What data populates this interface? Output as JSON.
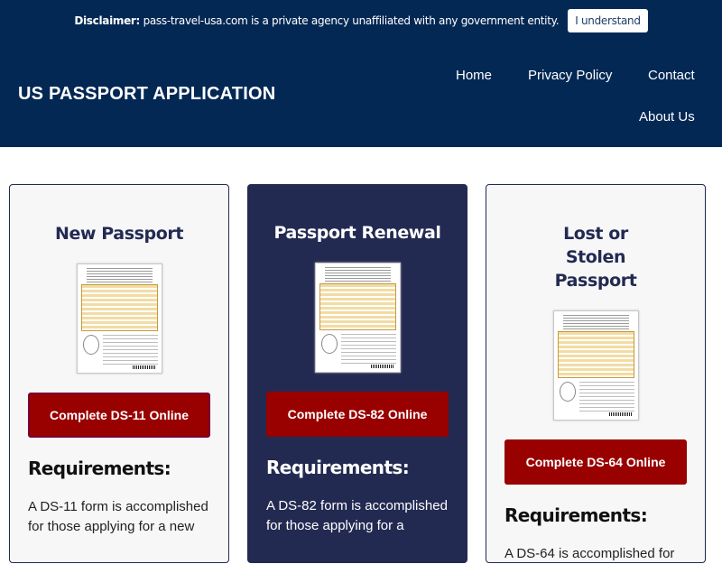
{
  "disclaimer": {
    "label": "Disclaimer:",
    "text": "pass-travel-usa.com is a private agency unaffiliated with any government entity.",
    "button": "I understand"
  },
  "header": {
    "title": "US PASSPORT APPLICATION",
    "nav": [
      "Home",
      "Privacy Policy",
      "Contact",
      "About Us"
    ]
  },
  "cards": [
    {
      "title": "New Passport",
      "image_alt": "DS-11 form",
      "button": "Complete DS-11 Online",
      "requirements_title": "Requirements:",
      "requirements_text": "A DS-11 form is accomplished for those applying for a new"
    },
    {
      "title": "Passport Renewal",
      "image_alt": "DS-82 form",
      "button": "Complete DS-82 Online",
      "requirements_title": "Requirements:",
      "requirements_text": "A DS-82 form is accomplished for those applying for a"
    },
    {
      "title": "Lost or Stolen Passport",
      "image_alt": "DS-64 form",
      "button": "Complete DS-64 Online",
      "requirements_title": "Requirements:",
      "requirements_text": "A DS-64 is accomplished for"
    }
  ],
  "colors": {
    "header_bg": "#032854",
    "featured_card_bg": "#232a52",
    "button_red": "#990000",
    "card_bg": "#f7f7f8"
  }
}
